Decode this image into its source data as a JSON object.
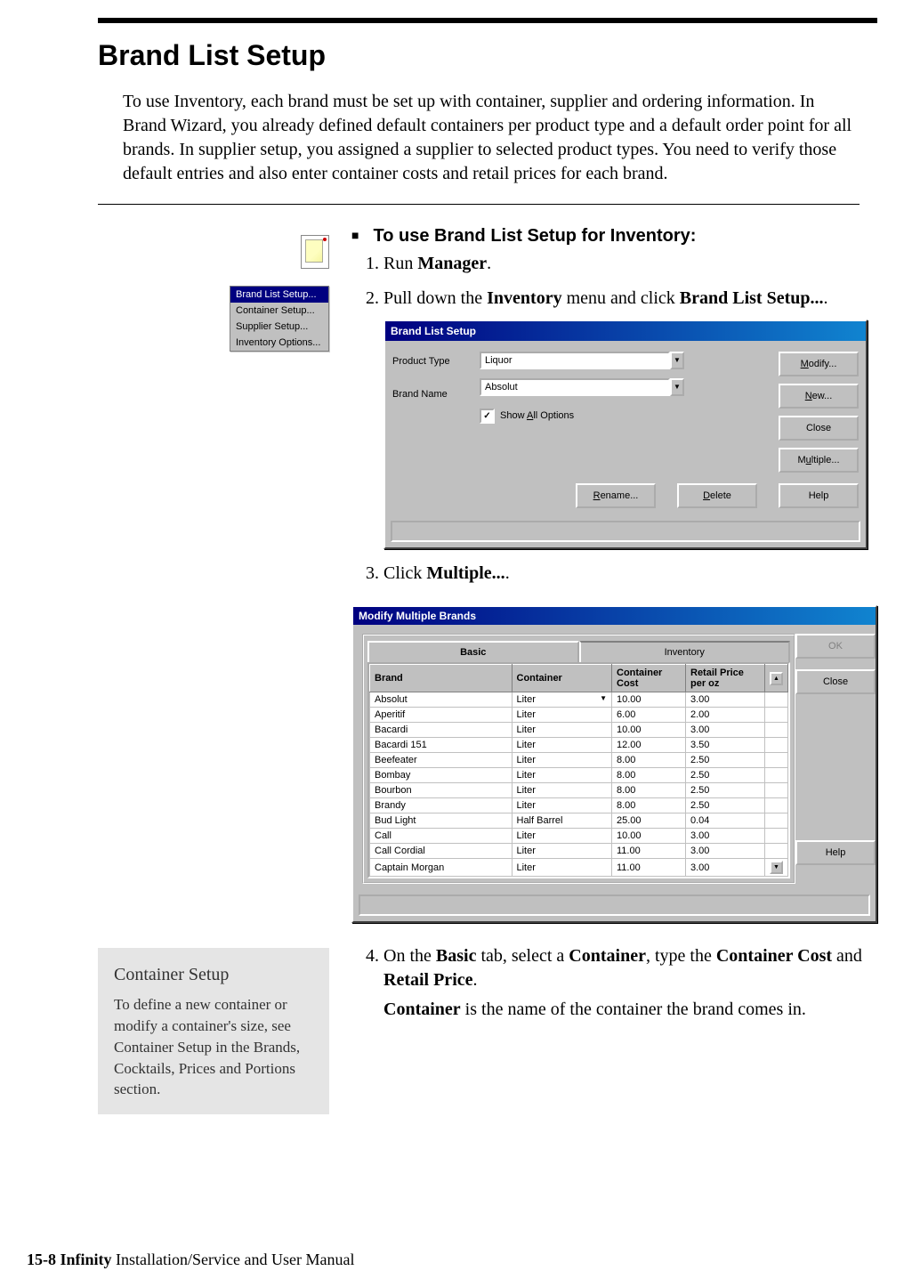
{
  "header": {
    "title": "Brand List Setup",
    "intro": "To use Inventory, each brand must be set up with container, supplier and ordering information. In Brand Wizard, you already defined default containers per product type and a default order point for all brands. In supplier setup, you assigned a supplier to selected product types. You need to verify those default entries and also enter container costs and retail prices for each brand."
  },
  "menu_shot": {
    "items": [
      "Brand List Setup...",
      "Container Setup...",
      "Supplier Setup...",
      "Inventory Options..."
    ],
    "selected_index": 0
  },
  "task": {
    "heading": "To use Brand List Setup for Inventory:",
    "step1_pre": "Run ",
    "step1_bold": "Manager",
    "step1_post": ".",
    "step2_pre": "Pull down the ",
    "step2_b1": "Inventory",
    "step2_mid": " menu and click ",
    "step2_b2": "Brand List Setup...",
    "step2_post": ".",
    "step3_pre": "Click ",
    "step3_bold": "Multiple...",
    "step3_post": "."
  },
  "bls_dialog": {
    "title": "Brand List Setup",
    "labels": {
      "product_type": "Product Type",
      "brand_name": "Brand Name"
    },
    "fields": {
      "product_type": "Liquor",
      "brand_name": "Absolut"
    },
    "checkbox": {
      "label": "Show All Options",
      "checked": true,
      "access": "A"
    },
    "buttons": {
      "modify": "Modify...",
      "new": "New...",
      "close": "Close",
      "multiple": "Multiple...",
      "rename": "Rename...",
      "delete": "Delete",
      "help": "Help"
    }
  },
  "mmb_dialog": {
    "title": "Modify Multiple Brands",
    "tabs": {
      "basic": "Basic",
      "inventory": "Inventory"
    },
    "buttons": {
      "ok": "OK",
      "close": "Close",
      "help": "Help"
    },
    "columns": {
      "brand": "Brand",
      "container": "Container",
      "cost": "Container Cost",
      "retail": "Retail Price per oz"
    },
    "rows": [
      {
        "brand": "Absolut",
        "container": "Liter",
        "cost": "10.00",
        "retail": "3.00"
      },
      {
        "brand": "Aperitif",
        "container": "Liter",
        "cost": "6.00",
        "retail": "2.00"
      },
      {
        "brand": "Bacardi",
        "container": "Liter",
        "cost": "10.00",
        "retail": "3.00"
      },
      {
        "brand": "Bacardi 151",
        "container": "Liter",
        "cost": "12.00",
        "retail": "3.50"
      },
      {
        "brand": "Beefeater",
        "container": "Liter",
        "cost": "8.00",
        "retail": "2.50"
      },
      {
        "brand": "Bombay",
        "container": "Liter",
        "cost": "8.00",
        "retail": "2.50"
      },
      {
        "brand": "Bourbon",
        "container": "Liter",
        "cost": "8.00",
        "retail": "2.50"
      },
      {
        "brand": "Brandy",
        "container": "Liter",
        "cost": "8.00",
        "retail": "2.50"
      },
      {
        "brand": "Bud Light",
        "container": "Half Barrel",
        "cost": "25.00",
        "retail": "0.04"
      },
      {
        "brand": "Call",
        "container": "Liter",
        "cost": "10.00",
        "retail": "3.00"
      },
      {
        "brand": "Call Cordial",
        "container": "Liter",
        "cost": "11.00",
        "retail": "3.00"
      },
      {
        "brand": "Captain Morgan",
        "container": "Liter",
        "cost": "11.00",
        "retail": "3.00"
      }
    ]
  },
  "step4": {
    "pre": "On the ",
    "b1": "Basic",
    "m1": " tab, select a ",
    "b2": "Container",
    "m2": ", type the ",
    "b3": "Container Cost",
    "m3": " and ",
    "b4": "Retail Price",
    "post": ".",
    "para2_b": "Container",
    "para2_rest": " is the name of the container the brand comes in."
  },
  "side_note": {
    "title": "Container Setup",
    "body": "To define a new container or modify a container's size, see Container Setup in the Brands, Cocktails, Prices and Portions section."
  },
  "footer": {
    "page": "15-8",
    "space": "  ",
    "product": "Infinity",
    "rest": " Installation/Service and User Manual"
  }
}
